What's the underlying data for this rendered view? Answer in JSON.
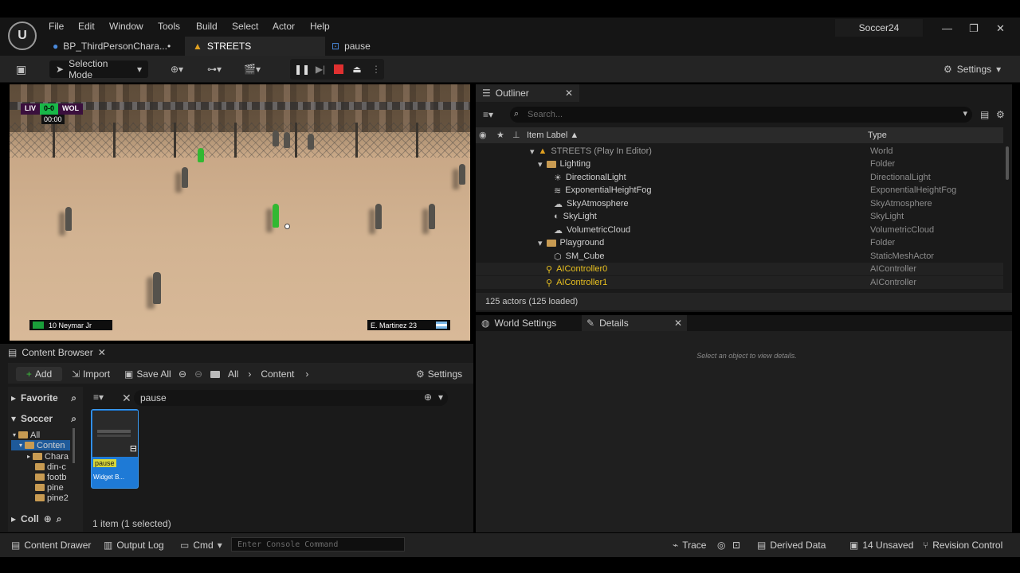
{
  "menu": {
    "items": [
      "File",
      "Edit",
      "Window",
      "Tools",
      "Build",
      "Select",
      "Actor",
      "Help"
    ],
    "logo": "U"
  },
  "project_name": "Soccer24",
  "window_controls": {
    "minimize": "—",
    "restore": "❐",
    "close": "✕"
  },
  "doc_tabs": [
    {
      "label": "BP_ThirdPersonChara...•",
      "icon": "person-icon"
    },
    {
      "label": "STREETS",
      "icon": "level-icon"
    },
    {
      "label": "pause",
      "icon": "widget-icon"
    }
  ],
  "toolbar": {
    "selection_mode": "Selection Mode",
    "settings": "Settings"
  },
  "viewport": {
    "scoreboard": {
      "home": "LIV",
      "score": "0-0",
      "away": "WOL",
      "clock": "00:00"
    },
    "home_player": "10  Neymar Jr",
    "away_player": "E. Martinez  23"
  },
  "outliner": {
    "tab_label": "Outliner",
    "search_placeholder": "Search...",
    "columns": {
      "label": "Item Label ▲",
      "type": "Type"
    },
    "rows": [
      {
        "label": "STREETS (Play In Editor)",
        "type": "World",
        "icon": "level-icon"
      },
      {
        "label": "Lighting",
        "type": "Folder",
        "icon": "folder-icon"
      },
      {
        "label": "DirectionalLight",
        "type": "DirectionalLight",
        "icon": "sun-icon"
      },
      {
        "label": "ExponentialHeightFog",
        "type": "ExponentialHeightFog",
        "icon": "fog-icon"
      },
      {
        "label": "SkyAtmosphere",
        "type": "SkyAtmosphere",
        "icon": "sky-icon"
      },
      {
        "label": "SkyLight",
        "type": "SkyLight",
        "icon": "skylight-icon"
      },
      {
        "label": "VolumetricCloud",
        "type": "VolumetricCloud",
        "icon": "cloud-icon"
      },
      {
        "label": "Playground",
        "type": "Folder",
        "icon": "folder-icon"
      },
      {
        "label": "SM_Cube",
        "type": "StaticMeshActor",
        "icon": "mesh-icon"
      },
      {
        "label": "AIController0",
        "type": "AIController",
        "icon": "controller-icon"
      },
      {
        "label": "AIController1",
        "type": "AIController",
        "icon": "controller-icon"
      }
    ],
    "actor_count": "125 actors (125 loaded)"
  },
  "details": {
    "tabs": [
      "World Settings",
      "Details"
    ],
    "hint": "Select an object to view details."
  },
  "content_browser": {
    "tab_label": "Content Browser",
    "toolbar": {
      "add": "Add",
      "import": "Import",
      "save_all": "Save All",
      "settings": "Settings"
    },
    "breadcrumb": [
      "All",
      "Content"
    ],
    "sidebar": {
      "favorites": "Favorite",
      "project": "Soccer",
      "collections": "Coll",
      "tree": [
        "All",
        "Conten",
        "Chara",
        "din-c",
        "footb",
        "pine",
        "pine2"
      ]
    },
    "filter_text": "pause",
    "asset": {
      "name": "pause",
      "type": "Widget B..."
    },
    "status": "1 item (1 selected)"
  },
  "statusbar": {
    "content_drawer": "Content Drawer",
    "output_log": "Output Log",
    "cmd": "Cmd",
    "console_placeholder": "Enter Console Command",
    "trace": "Trace",
    "derived_data": "Derived Data",
    "unsaved": "14 Unsaved",
    "revision_control": "Revision Control"
  },
  "colors": {
    "accent": "#1e7ad6",
    "green": "#18b848",
    "folder": "#c89b52",
    "ai_controller": "#e8c020"
  }
}
